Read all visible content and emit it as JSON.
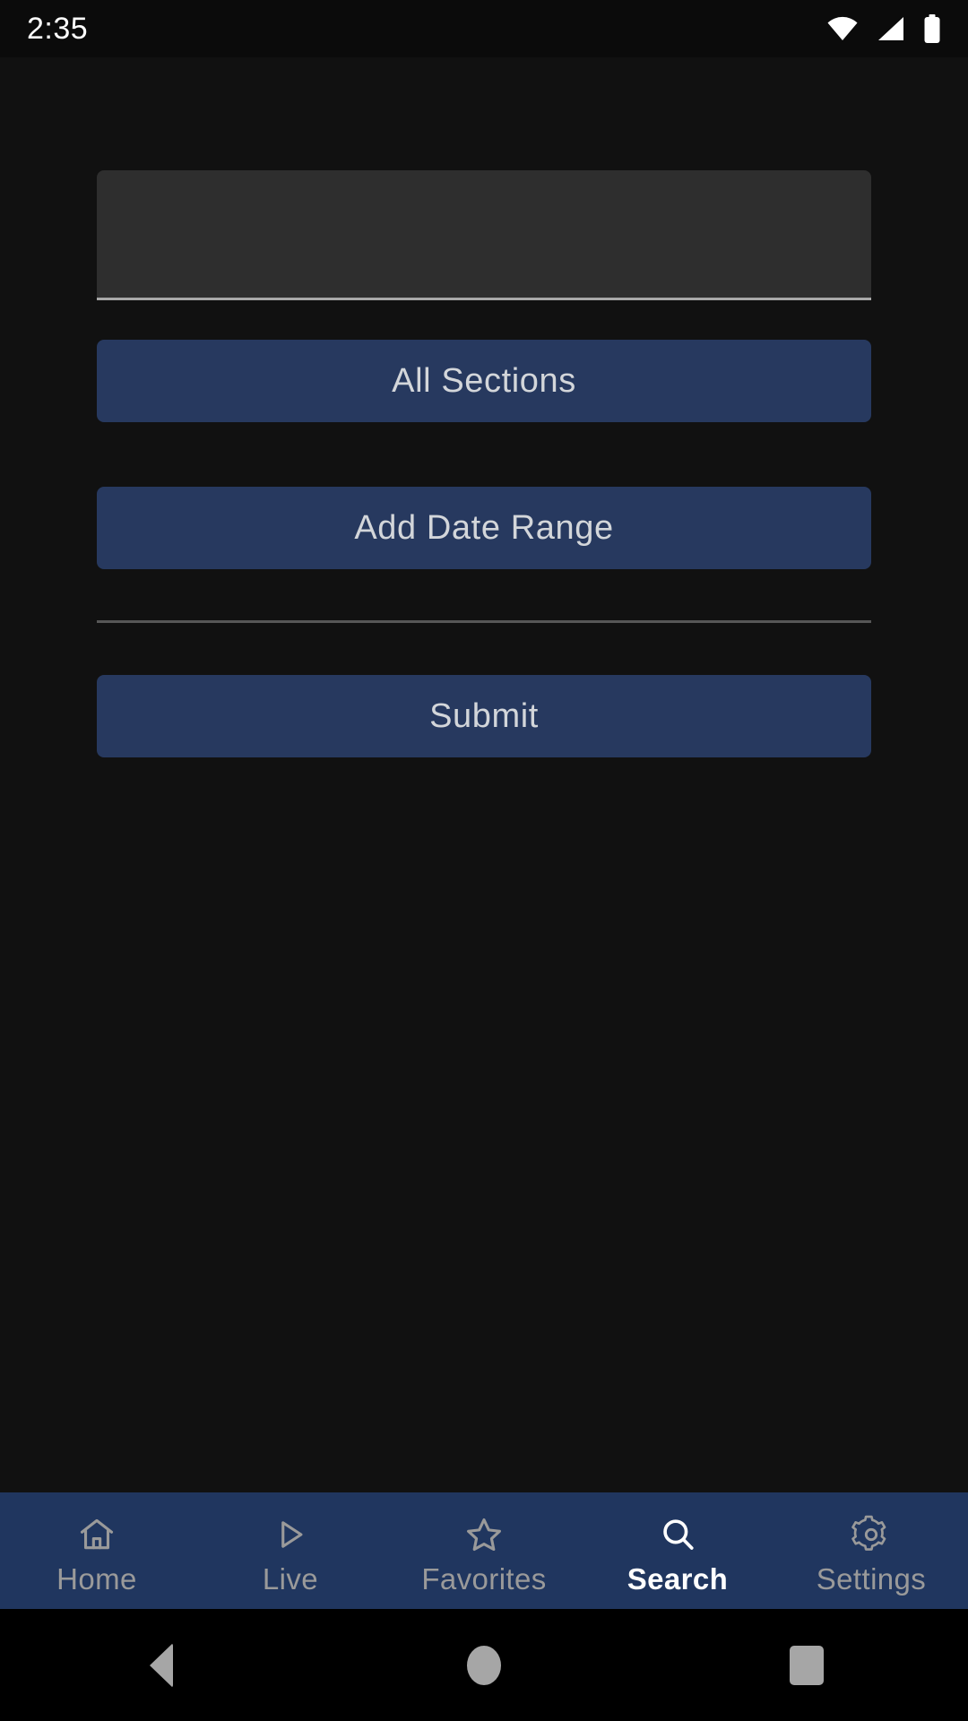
{
  "status_bar": {
    "time": "2:35",
    "icons": [
      "wifi-icon",
      "cellular-signal-icon",
      "battery-icon"
    ]
  },
  "search_form": {
    "query_input": {
      "value": "",
      "placeholder": ""
    },
    "sections_button_label": "All Sections",
    "date_range_button_label": "Add Date Range",
    "submit_button_label": "Submit"
  },
  "bottom_nav": {
    "active": "Search",
    "items": [
      {
        "label": "Home",
        "icon": "home-icon",
        "active": false
      },
      {
        "label": "Live",
        "icon": "play-icon",
        "active": false
      },
      {
        "label": "Favorites",
        "icon": "star-icon",
        "active": false
      },
      {
        "label": "Search",
        "icon": "search-icon",
        "active": true
      },
      {
        "label": "Settings",
        "icon": "gear-icon",
        "active": false
      }
    ]
  },
  "system_nav": {
    "back_label": "Back",
    "home_label": "Home",
    "recents_label": "Recents"
  },
  "colors": {
    "background": "#111111",
    "accent_navy": "#27395f",
    "nav_bar": "#20365f",
    "field_fill": "#2e2e2e",
    "button_text": "#d3d6da",
    "active_text": "#ffffff",
    "inactive_text": "#9a9a9a",
    "divider": "#575757"
  }
}
